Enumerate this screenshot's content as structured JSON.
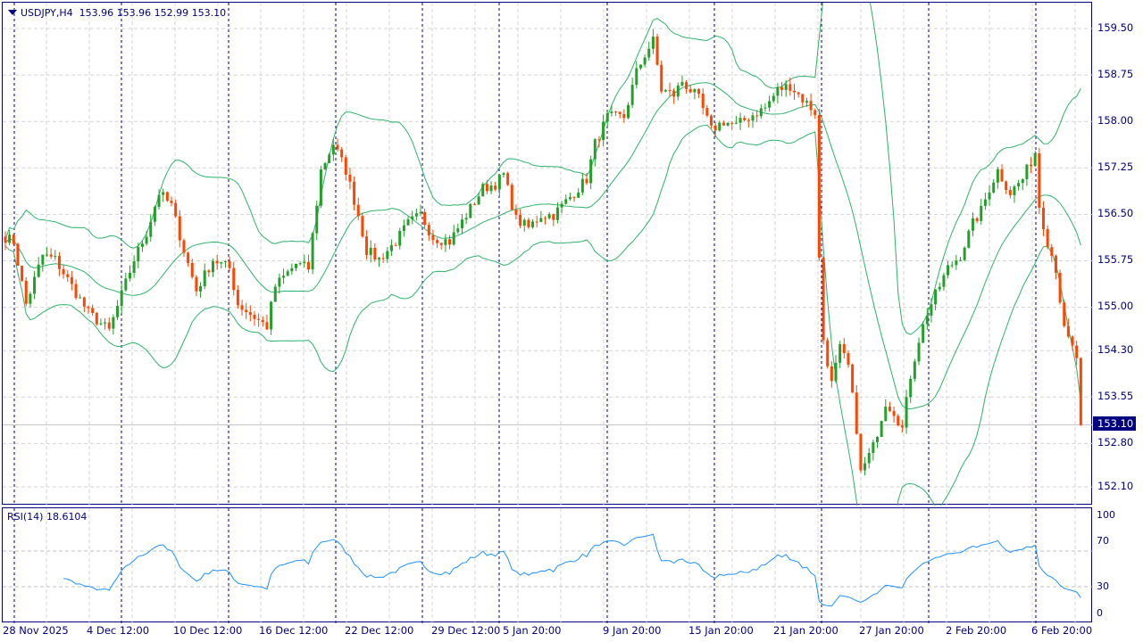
{
  "header": {
    "symbol": "USDJPY,H4",
    "open": "153.96",
    "high": "153.96",
    "low": "152.99",
    "close": "153.10"
  },
  "price_axis": [
    "159.50",
    "158.75",
    "158.00",
    "157.25",
    "156.50",
    "155.75",
    "155.00",
    "154.30",
    "153.55",
    "152.80",
    "152.10"
  ],
  "current_price": "153.10",
  "rsi": {
    "label": "RSI(14) 18.6104",
    "axis": [
      "100",
      "70",
      "30",
      "0"
    ]
  },
  "time_axis": [
    "28 Nov 2025",
    "4 Dec 12:00",
    "10 Dec 12:00",
    "16 Dec 12:00",
    "22 Dec 12:00",
    "29 Dec 12:00",
    "5 Jan 20:00",
    "9 Jan 20:00",
    "15 Jan 20:00",
    "21 Jan 20:00",
    "27 Jan 20:00",
    "2 Feb 20:00",
    "6 Feb 20:00"
  ],
  "colors": {
    "bull": "#22a02a",
    "bear": "#ff4500",
    "bands": "#2eb36b",
    "rsi": "#1e90ff",
    "frame": "#000080"
  },
  "chart_data": {
    "type": "candlestick",
    "title": "USDJPY,H4",
    "ylim": [
      151.85,
      159.9
    ],
    "indicators": [
      "Bollinger Bands(20,2)",
      "RSI(14)"
    ],
    "close_waypoints": [
      [
        0,
        156.13
      ],
      [
        2,
        156.06
      ],
      [
        5,
        155.05
      ],
      [
        9,
        155.84
      ],
      [
        12,
        155.77
      ],
      [
        16,
        155.34
      ],
      [
        20,
        154.91
      ],
      [
        25,
        154.62
      ],
      [
        28,
        155.2
      ],
      [
        31,
        155.77
      ],
      [
        34,
        156.2
      ],
      [
        37,
        156.85
      ],
      [
        40,
        156.64
      ],
      [
        43,
        155.92
      ],
      [
        46,
        155.27
      ],
      [
        50,
        155.77
      ],
      [
        54,
        155.63
      ],
      [
        56,
        155.05
      ],
      [
        60,
        154.84
      ],
      [
        63,
        154.69
      ],
      [
        65,
        155.34
      ],
      [
        70,
        155.7
      ],
      [
        73,
        155.63
      ],
      [
        76,
        157.21
      ],
      [
        79,
        157.64
      ],
      [
        82,
        157.21
      ],
      [
        85,
        156.49
      ],
      [
        87,
        155.92
      ],
      [
        90,
        155.77
      ],
      [
        94,
        156.06
      ],
      [
        97,
        156.35
      ],
      [
        100,
        156.49
      ],
      [
        103,
        156.13
      ],
      [
        107,
        156.06
      ],
      [
        111,
        156.49
      ],
      [
        115,
        156.92
      ],
      [
        118,
        156.99
      ],
      [
        120,
        157.14
      ],
      [
        123,
        156.42
      ],
      [
        126,
        156.28
      ],
      [
        129,
        156.49
      ],
      [
        132,
        156.49
      ],
      [
        137,
        156.85
      ],
      [
        140,
        157.07
      ],
      [
        142,
        157.64
      ],
      [
        145,
        158.07
      ],
      [
        149,
        158.07
      ],
      [
        152,
        158.79
      ],
      [
        154,
        159.08
      ],
      [
        156,
        159.3
      ],
      [
        158,
        158.51
      ],
      [
        161,
        158.43
      ],
      [
        163,
        158.65
      ],
      [
        167,
        158.36
      ],
      [
        170,
        157.86
      ],
      [
        173,
        158.0
      ],
      [
        176,
        157.93
      ],
      [
        179,
        158.07
      ],
      [
        183,
        158.22
      ],
      [
        186,
        158.51
      ],
      [
        189,
        158.58
      ],
      [
        192,
        158.36
      ],
      [
        195,
        158.15
      ],
      [
        196,
        155.77
      ],
      [
        197,
        154.48
      ],
      [
        199,
        153.76
      ],
      [
        201,
        154.33
      ],
      [
        203,
        154.04
      ],
      [
        205,
        153.04
      ],
      [
        206,
        152.32
      ],
      [
        209,
        152.75
      ],
      [
        212,
        153.47
      ],
      [
        214,
        153.32
      ],
      [
        216,
        153.04
      ],
      [
        218,
        153.9
      ],
      [
        220,
        154.48
      ],
      [
        222,
        154.91
      ],
      [
        224,
        155.2
      ],
      [
        227,
        155.63
      ],
      [
        230,
        155.84
      ],
      [
        233,
        156.35
      ],
      [
        235,
        156.56
      ],
      [
        237,
        156.92
      ],
      [
        239,
        157.21
      ],
      [
        242,
        156.85
      ],
      [
        245,
        157.07
      ],
      [
        248,
        157.5
      ],
      [
        249,
        156.64
      ],
      [
        251,
        156.06
      ],
      [
        253,
        155.63
      ],
      [
        255,
        154.62
      ],
      [
        258,
        154.19
      ],
      [
        259,
        153.1
      ]
    ]
  }
}
